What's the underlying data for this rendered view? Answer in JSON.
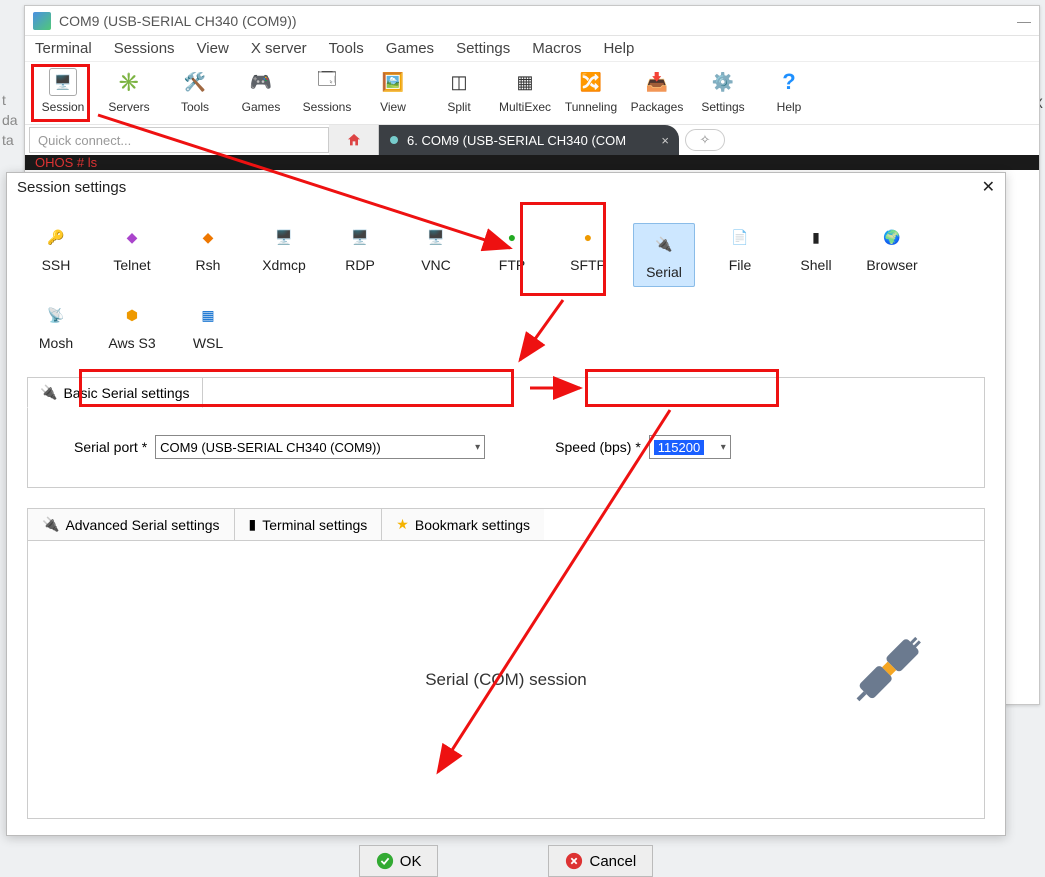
{
  "window": {
    "title": "COM9  (USB-SERIAL CH340 (COM9))",
    "minimize": "—"
  },
  "menubar": [
    "Terminal",
    "Sessions",
    "View",
    "X server",
    "Tools",
    "Games",
    "Settings",
    "Macros",
    "Help"
  ],
  "toolbar": [
    {
      "label": "Session"
    },
    {
      "label": "Servers"
    },
    {
      "label": "Tools"
    },
    {
      "label": "Games"
    },
    {
      "label": "Sessions"
    },
    {
      "label": "View"
    },
    {
      "label": "Split"
    },
    {
      "label": "MultiExec"
    },
    {
      "label": "Tunneling"
    },
    {
      "label": "Packages"
    },
    {
      "label": "Settings"
    },
    {
      "label": "Help"
    }
  ],
  "quick_connect_placeholder": "Quick connect...",
  "tab": {
    "label": "6. COM9  (USB-SERIAL CH340 (COM",
    "close": "×"
  },
  "terminal_line": "OHOS # ls",
  "dialog": {
    "title": "Session settings",
    "protocols": [
      "SSH",
      "Telnet",
      "Rsh",
      "Xdmcp",
      "RDP",
      "VNC",
      "FTP",
      "SFTP",
      "Serial",
      "File",
      "Shell",
      "Browser",
      "Mosh",
      "Aws S3",
      "WSL"
    ],
    "basic_tab_label": "Basic Serial settings",
    "serial_port_label": "Serial port *",
    "serial_port_value": "COM9  (USB-SERIAL CH340 (COM9))",
    "speed_label": "Speed (bps) *",
    "speed_value": "115200",
    "adv_tabs": [
      "Advanced Serial settings",
      "Terminal settings",
      "Bookmark settings"
    ],
    "session_type_label": "Serial (COM) session",
    "ok": "OK",
    "cancel": "Cancel"
  },
  "bg_hints": [
    "t",
    "da",
    "ta"
  ],
  "right_x": "X"
}
